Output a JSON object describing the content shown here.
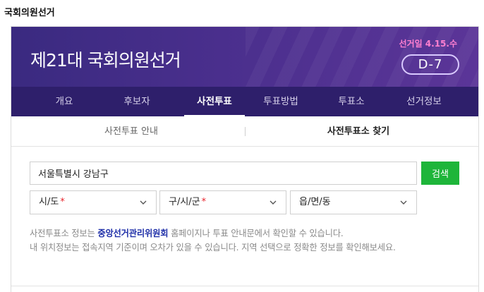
{
  "page": {
    "heading": "국회의원선거"
  },
  "banner": {
    "title": "제21대 국회의원선거",
    "election_date": "선거일 4.15.수",
    "dday": "D-7"
  },
  "nav": {
    "items": [
      {
        "label": "개요"
      },
      {
        "label": "후보자"
      },
      {
        "label": "사전투표"
      },
      {
        "label": "투표방법"
      },
      {
        "label": "투표소"
      },
      {
        "label": "선거정보"
      }
    ],
    "active": "사전투표"
  },
  "subtabs": {
    "items": [
      {
        "label": "사전투표 안내"
      },
      {
        "label": "사전투표소 찾기"
      }
    ],
    "active": "사전투표소 찾기"
  },
  "search": {
    "value": "서울특별시 강남구",
    "button_label": "검색"
  },
  "filters": {
    "sido": {
      "label": "시/도",
      "required_mark": "*"
    },
    "gugun": {
      "label": "구/시/군",
      "required_mark": "*"
    },
    "dong": {
      "label": "읍/면/동"
    }
  },
  "notice": {
    "part1": "사전투표소 정보는 ",
    "link": "중앙선거관리위원회",
    "part2": " 홈페이지나 투표 안내문에서 확인할 수 있습니다.",
    "line2": "내 위치정보는 접속지역 기준이며 오차가 있을 수 있습니다. 지역 선택으로 정확한 정보를 확인해보세요."
  },
  "colors": {
    "banner": "#4a2f8d",
    "nav": "#2e1f6b",
    "accent_pink": "#ff7fd0",
    "search_button": "#1eb53a",
    "required": "#e8242c",
    "highlight": "#1f2fa8"
  }
}
